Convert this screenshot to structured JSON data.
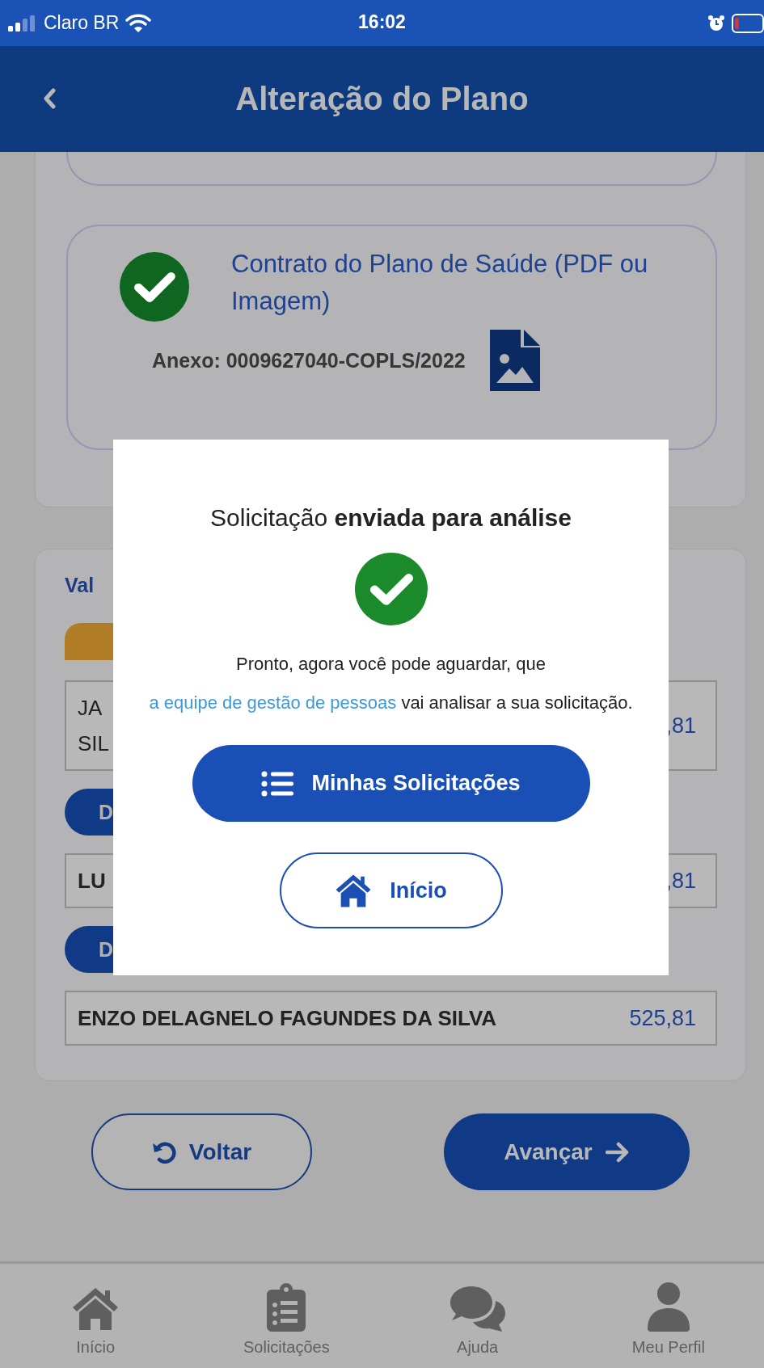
{
  "status_bar": {
    "carrier": "Claro BR",
    "time": "16:02"
  },
  "header": {
    "title": "Alteração do Plano"
  },
  "attachment_card": {
    "title": "Contrato do Plano de Saúde (PDF ou Imagem)",
    "attachment": "Anexo: 0009627040-COPLS/2022"
  },
  "values_card": {
    "heading": "Val",
    "items": [
      {
        "kind": "band"
      },
      {
        "kind": "holder",
        "name_lines": [
          "JA",
          "SIL"
        ],
        "amount": ",81"
      },
      {
        "kind": "button",
        "label": "D"
      },
      {
        "kind": "dependent",
        "name_lines": [
          "LU"
        ],
        "amount": ",81"
      },
      {
        "kind": "button",
        "label": "D"
      },
      {
        "kind": "dependent",
        "name_lines": [
          "ENZO DELAGNELO FAGUNDES DA SILVA"
        ],
        "amount": "525,81"
      }
    ]
  },
  "footer_buttons": [
    {
      "kind": "outline",
      "label": "Voltar"
    },
    {
      "kind": "filled",
      "label": "Avançar"
    }
  ],
  "dialog": {
    "title": "Solicitação **enviada para análise**",
    "message_start": "Pronto, agora você pode aguardar, que ",
    "message_link": "a equipe de gestão de pessoas",
    "message_end": " vai analisar a sua solicitação.",
    "buttons": [
      {
        "kind": "filled",
        "label": "Minhas Solicitações"
      },
      {
        "kind": "outline",
        "label": "Início"
      }
    ]
  },
  "tab_bar": [
    {
      "kind": "home",
      "label": "Início"
    },
    {
      "kind": "clipboard",
      "label": "Solicitações"
    },
    {
      "kind": "chat",
      "label": "Ajuda"
    },
    {
      "kind": "person",
      "label": "Meu Perfil"
    }
  ]
}
